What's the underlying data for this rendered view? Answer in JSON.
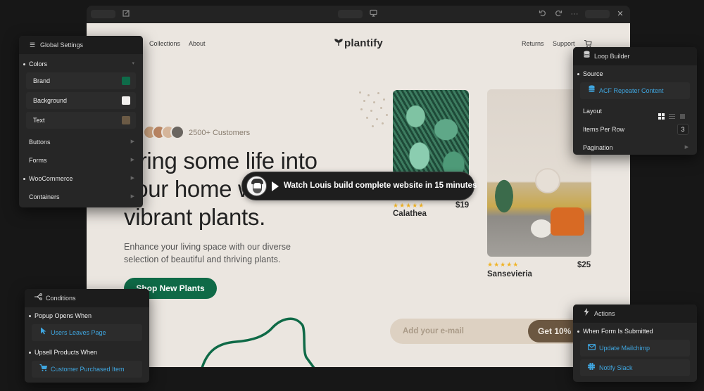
{
  "editor": {
    "toolbar": {
      "icons": [
        "edit-icon",
        "desktop-preview-icon",
        "undo-icon",
        "redo-icon",
        "more-icon",
        "close-icon"
      ]
    }
  },
  "site": {
    "nav": {
      "links_left": [
        "Collections",
        "About"
      ],
      "logo": "plantify",
      "links_right": [
        "Returns",
        "Support"
      ],
      "cart_icon": "cart-icon"
    },
    "hero": {
      "customers": "2500+ Customers",
      "title_lines": [
        "Bring some life into",
        "your home with",
        "vibrant plants."
      ],
      "description": "Enhance your living space with our diverse selection of beautiful and thriving plants.",
      "cta": "Shop New Plants"
    },
    "products": [
      {
        "name": "Calathea",
        "price": "$19",
        "rating": 5,
        "stars": "★★★★★"
      },
      {
        "name": "Sansevieria",
        "price": "$25",
        "rating": 5,
        "stars": "★★★★★"
      }
    ],
    "newsletter": {
      "placeholder": "Add your e-mail",
      "button": "Get 10% Off"
    },
    "video": {
      "label": "Watch Louis build complete website in 15 minutes"
    },
    "colors": {
      "brand": "#0f6a47",
      "background": "#ebe6e0",
      "text": "#6b5741"
    }
  },
  "global_settings": {
    "title": "Global Settings",
    "colors_section": "Colors",
    "colors": [
      {
        "label": "Brand",
        "value": "#0e6b49"
      },
      {
        "label": "Background",
        "value": "#f2f0ee"
      },
      {
        "label": "Text",
        "value": "#6b5a45"
      }
    ],
    "items": [
      {
        "label": "Buttons",
        "bullet": false
      },
      {
        "label": "Forms",
        "bullet": false
      },
      {
        "label": "WooCommerce",
        "bullet": true
      },
      {
        "label": "Containers",
        "bullet": false
      }
    ]
  },
  "loop_builder": {
    "title": "Loop Builder",
    "source_label": "Source",
    "source_value": "ACF Repeater Content",
    "layout_label": "Layout",
    "layout_options": [
      "grid",
      "list",
      "single"
    ],
    "layout_selected": "grid",
    "items_per_row_label": "Items Per Row",
    "items_per_row": "3",
    "pagination_label": "Pagination"
  },
  "conditions": {
    "title": "Conditions",
    "groups": [
      {
        "label": "Popup Opens When",
        "value": "Users Leaves Page",
        "icon": "cursor-icon"
      },
      {
        "label": "Upsell Products When",
        "value": "Customer Purchased Item",
        "icon": "cart-icon"
      }
    ]
  },
  "actions": {
    "title": "Actions",
    "trigger": "When Form Is Submitted",
    "items": [
      {
        "label": "Update Mailchimp",
        "icon": "mail-icon"
      },
      {
        "label": "Notify Slack",
        "icon": "slack-icon"
      }
    ]
  }
}
